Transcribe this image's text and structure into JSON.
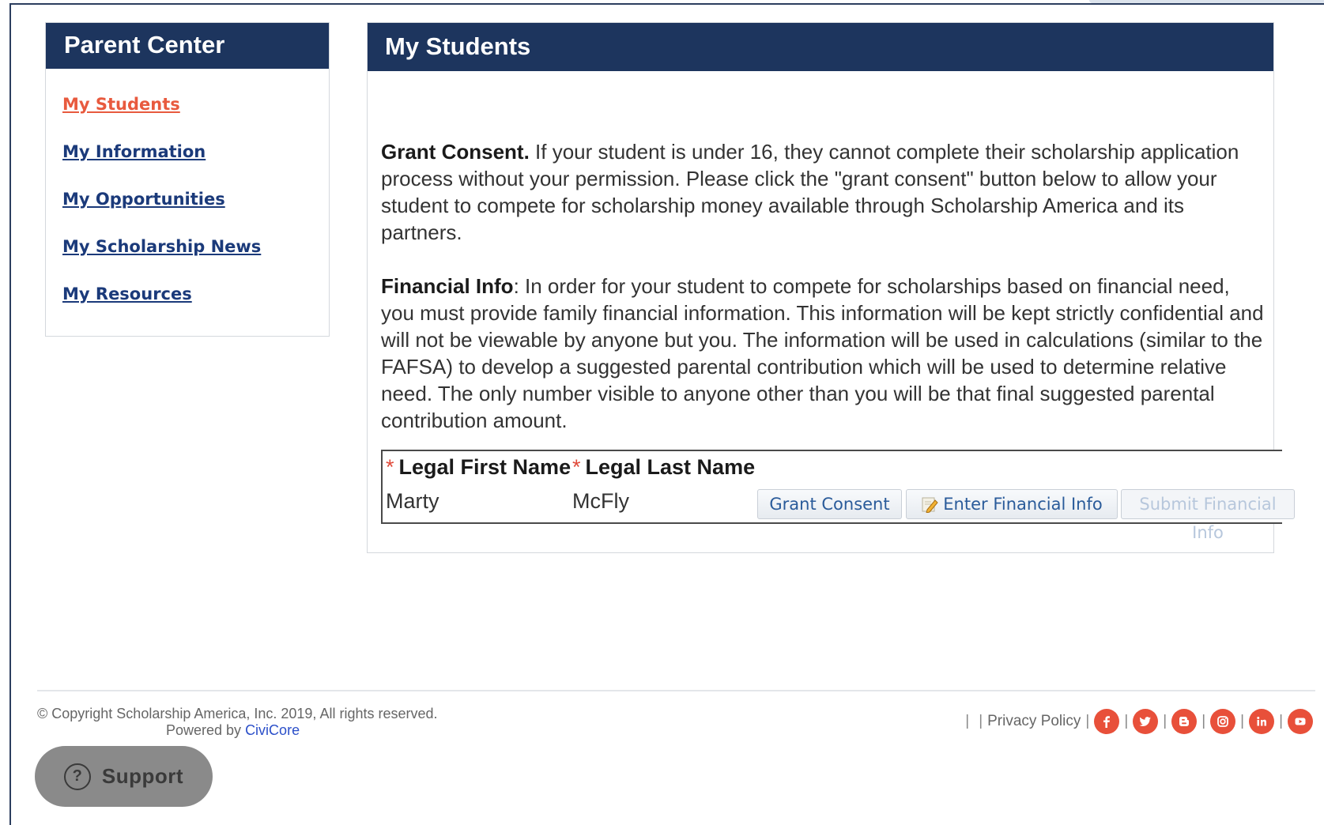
{
  "sidebar": {
    "title": "Parent Center",
    "items": [
      {
        "label": "My Students",
        "active": true
      },
      {
        "label": "My Information",
        "active": false
      },
      {
        "label": "My Opportunities",
        "active": false
      },
      {
        "label": "My Scholarship News",
        "active": false
      },
      {
        "label": "My Resources",
        "active": false
      }
    ]
  },
  "main": {
    "title": "My Students",
    "grant_consent": {
      "heading": "Grant Consent.",
      "text": " If your student is under 16, they cannot complete their scholarship application process without your permission. Please click the \"grant consent\" button below to allow your student to compete for scholarship money available through Scholarship America and its partners."
    },
    "financial_info": {
      "heading": "Financial Info",
      "text": ": In order for your student to compete for scholarships based on financial need, you must provide family financial information. This information will be kept strictly confidential and will not be viewable by anyone but you. The information will be used in calculations (similar to the FAFSA) to develop a suggested parental contribution which will be used to determine relative need. The only number visible to anyone other than you will be that final suggested parental contribution amount."
    },
    "table": {
      "required_mark": "*",
      "headers": [
        "Legal First Name",
        "Legal Last Name"
      ],
      "rows": [
        {
          "first_name": "Marty",
          "last_name": "McFly"
        }
      ],
      "buttons": {
        "grant": "Grant Consent",
        "enter": "Enter Financial Info",
        "submit": "Submit Financial Info"
      }
    }
  },
  "footer": {
    "copyright": "© Copyright Scholarship America, Inc. 2019, All rights reserved.",
    "powered_prefix": "Powered by ",
    "powered_link": "CiviCore",
    "privacy": "Privacy Policy",
    "separator": "|",
    "social_icons": [
      "facebook-icon",
      "twitter-icon",
      "blogger-icon",
      "instagram-icon",
      "linkedin-icon",
      "youtube-icon"
    ],
    "accent_color": "#e8503a"
  },
  "support": {
    "label": "Support",
    "icon_glyph": "?"
  },
  "colors": {
    "header_bg": "#1d355e",
    "link": "#1b3a7a",
    "active_link": "#e85a3e"
  }
}
